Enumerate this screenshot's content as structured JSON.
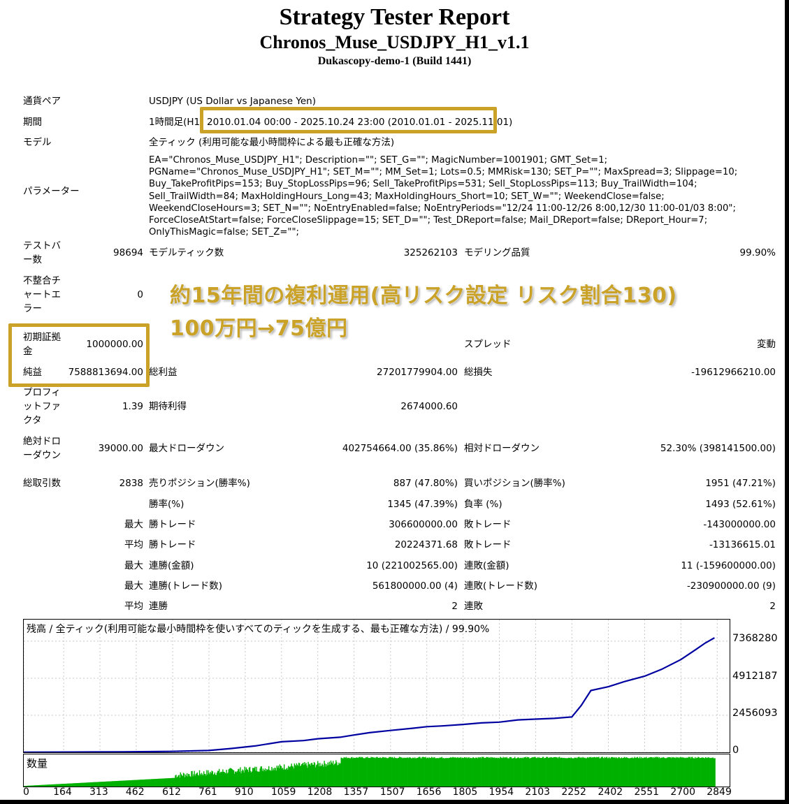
{
  "header": {
    "title": "Strategy Tester Report",
    "ea_name": "Chronos_Muse_USDJPY_H1_v1.1",
    "server": "Dukascopy-demo-1 (Build 1441)"
  },
  "info": {
    "pair_label": "通貨ペア",
    "pair_value": "USDJPY (US Dollar vs Japanese Yen)",
    "period_label": "期間",
    "period_prefix": "1時間足(H1",
    "period_value": "2010.01.04 00:00 - 2025.10.24 23:00 (2010.01.01 - 2025.11.01)",
    "model_label": "モデル",
    "model_value": "全ティック (利用可能な最小時間枠による最も正確な方法)",
    "params_label": "パラメーター",
    "params_value": "EA=\"Chronos_Muse_USDJPY_H1\"; Description=\"\"; SET_G=\"\"; MagicNumber=1001901; GMT_Set=1; PGName=\"Chronos_Muse_USDJPY_H1\"; SET_M=\"\"; MM_Set=1; Lots=0.5; MMRisk=130; SET_P=\"\"; MaxSpread=3; Slippage=10; Buy_TakeProfitPips=153; Buy_StopLossPips=96; Sell_TakeProfitPips=531; Sell_StopLossPips=113; Buy_TrailWidth=104; Sell_TrailWidth=84; MaxHoldingHours_Long=43; MaxHoldingHours_Short=10; SET_W=\"\"; WeekendClose=false; WeekendCloseHours=3; SET_N=\"\"; NoEntryEnabled=false; NoEntryPeriods=\"12/24 11:00-12/26 8:00,12/30 11:00-01/03 8:00\"; ForceCloseAtStart=false; ForceCloseSlippage=15; SET_D=\"\"; Test_DReport=false; Mail_DReport=false; DReport_Hour=7; OnlyThisMagic=false; SET_Z=\"\";"
  },
  "stats": {
    "test_bars_label": "テストバー数",
    "test_bars": "98694",
    "model_ticks_label": "モデルティック数",
    "model_ticks": "325262103",
    "model_quality_label": "モデリング品質",
    "model_quality": "99.90%",
    "mismatch_label": "不整合チャートエラー",
    "mismatch": "0",
    "initial_deposit_label": "初期証拠金",
    "initial_deposit": "1000000.00",
    "spread_label": "スプレッド",
    "spread": "変動",
    "net_profit_label": "純益",
    "net_profit": "7588813694.00",
    "gross_profit_label": "総利益",
    "gross_profit": "27201779904.00",
    "gross_loss_label": "総損失",
    "gross_loss": "-19612966210.00",
    "profit_factor_label": "プロフィットファクタ",
    "profit_factor": "1.39",
    "expected_payoff_label": "期待利得",
    "expected_payoff": "2674000.60",
    "abs_dd_label": "絶対ドローダウン",
    "abs_dd": "39000.00",
    "max_dd_label": "最大ドローダウン",
    "max_dd": "402754664.00 (35.86%)",
    "rel_dd_label": "相対ドローダウン",
    "rel_dd": "52.30% (398141500.00)",
    "total_trades_label": "総取引数",
    "total_trades": "2838",
    "short_label": "売りポジション(勝率%)",
    "short": "887 (47.80%)",
    "long_label": "買いポジション(勝率%)",
    "long": "1951 (47.21%)",
    "win_rate_label": "勝率(%)",
    "win_rate": "1345 (47.39%)",
    "loss_rate_label": "負率 (%)",
    "loss_rate": "1493 (52.61%)",
    "max_label": "最大",
    "avg_label": "平均",
    "largest_win_label": "勝トレード",
    "largest_win": "306600000.00",
    "largest_loss_label": "敗トレード",
    "largest_loss": "-143000000.00",
    "avg_win_label": "勝トレード",
    "avg_win": "20224371.68",
    "avg_loss_label": "敗トレード",
    "avg_loss": "-13136615.01",
    "max_consec_wins_money_label": "連勝(金額)",
    "max_consec_wins_money": "10 (221002565.00)",
    "max_consec_losses_money_label": "連敗(金額)",
    "max_consec_losses_money": "11 (-159600000.00)",
    "max_consec_wins_count_label": "連勝(トレード数)",
    "max_consec_wins_count": "561800000.00 (4)",
    "max_consec_losses_count_label": "連敗(トレード数)",
    "max_consec_losses_count": "-230900000.00 (9)",
    "avg_consec_wins_label": "連勝",
    "avg_consec_wins": "2",
    "avg_consec_losses_label": "連敗",
    "avg_consec_losses": "2"
  },
  "annotation": {
    "line1": "約15年間の複利運用(高リスク設定 リスク割合130)",
    "line2": "100万円→75億円",
    "color": "#c9a227"
  },
  "chart": {
    "title": "残高 / 全ティック(利用可能な最小時間枠を使いすべてのティックを生成する、最も正確な方法) / 99.90%",
    "volume_label": "数量",
    "y_ticks": [
      "7368280",
      "4912187",
      "2456093",
      "0"
    ],
    "x_ticks": [
      "0",
      "164",
      "313",
      "462",
      "612",
      "761",
      "910",
      "1059",
      "1208",
      "1357",
      "1507",
      "1656",
      "1805",
      "1954",
      "2103",
      "2252",
      "2402",
      "2551",
      "2700",
      "2849"
    ],
    "line_color": "#0000a0",
    "volume_color": "#00b000"
  },
  "chart_data": {
    "type": "line",
    "title": "残高 / 全ティック(利用可能な最小時間枠を使いすべてのティックを生成する、最も正確な方法) / 99.90%",
    "xlabel": "",
    "ylabel": "",
    "xlim": [
      0,
      2900
    ],
    "ylim": [
      0,
      8800000
    ],
    "series": [
      {
        "name": "残高",
        "x": [
          0,
          200,
          400,
          600,
          760,
          850,
          950,
          1059,
          1150,
          1208,
          1300,
          1357,
          1420,
          1507,
          1600,
          1656,
          1720,
          1805,
          1880,
          1954,
          2030,
          2103,
          2180,
          2252,
          2290,
          2330,
          2402,
          2470,
          2551,
          2620,
          2700,
          2760,
          2800,
          2838
        ],
        "y": [
          10000,
          20000,
          30000,
          60000,
          120000,
          250000,
          420000,
          700000,
          780000,
          900000,
          1000000,
          1150000,
          1300000,
          1450000,
          1600000,
          1700000,
          1750000,
          1850000,
          1950000,
          2000000,
          2150000,
          2200000,
          2250000,
          2350000,
          3100000,
          4100000,
          4350000,
          4700000,
          5050000,
          5500000,
          6150000,
          6800000,
          7250000,
          7590000
        ]
      }
    ],
    "grid": true,
    "legend": "none"
  }
}
